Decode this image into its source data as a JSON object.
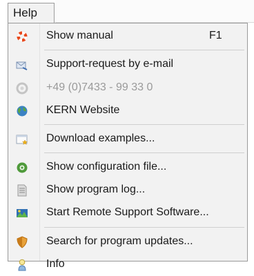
{
  "menubar": {
    "menu_title": "Help"
  },
  "menu_items": [
    {
      "label": "Show manual",
      "shortcut": "F1",
      "icon": "lifebuoy-icon"
    },
    {
      "label": "Support-request by e-mail",
      "icon": "mail-request-icon"
    },
    {
      "label": "+49 (0)7433 - 99 33 0",
      "icon": "phone-icon",
      "enabled": false
    },
    {
      "label": "KERN Website",
      "icon": "globe-icon"
    },
    {
      "label": "Download examples...",
      "icon": "download-star-icon"
    },
    {
      "label": "Show configuration file...",
      "icon": "config-file-icon"
    },
    {
      "label": "Show program log...",
      "icon": "log-file-icon"
    },
    {
      "label": "Start Remote Support Software...",
      "icon": "remote-support-icon"
    },
    {
      "label": "Search for program updates...",
      "icon": "update-shield-icon"
    },
    {
      "label": "Info",
      "icon": "info-person-icon"
    }
  ]
}
